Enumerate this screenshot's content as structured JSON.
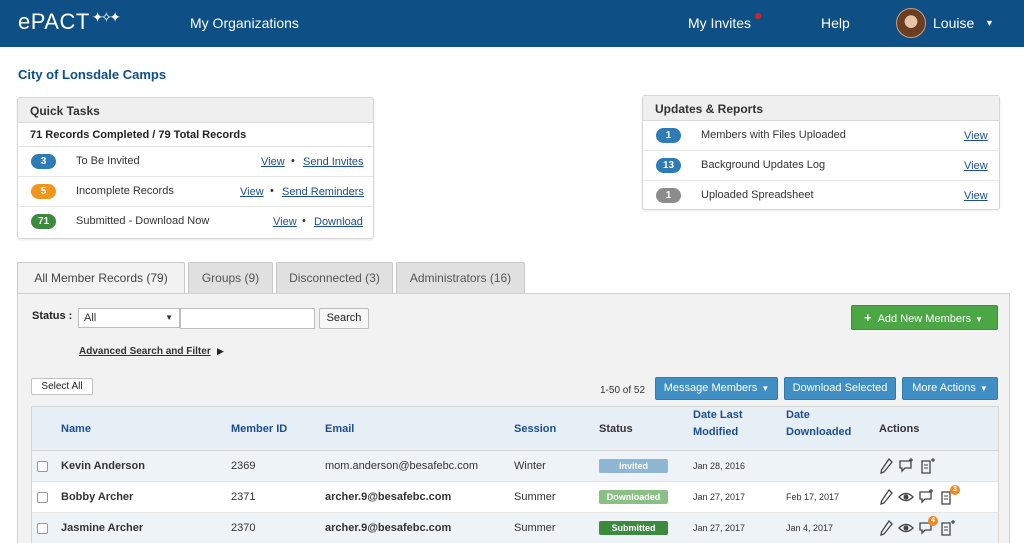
{
  "app": {
    "logo": "ePACT",
    "nav": {
      "organizations": "My Organizations",
      "invites": "My Invites",
      "help": "Help",
      "user": "Louise"
    }
  },
  "org_title": "City of Lonsdale Camps",
  "quick_tasks": {
    "title": "Quick Tasks",
    "summary": "71 Records Completed / 79 Total Records",
    "rows": [
      {
        "count": "3",
        "color": "#2e7bb6",
        "label": "To Be Invited",
        "view": "View",
        "action": "Send Invites"
      },
      {
        "count": "5",
        "color": "#f0961f",
        "label": "Incomplete Records",
        "view": "View",
        "action": "Send Reminders"
      },
      {
        "count": "71",
        "color": "#3b8a3e",
        "label": "Submitted - Download Now",
        "view": "View",
        "action": "Download"
      }
    ]
  },
  "updates_reports": {
    "title": "Updates & Reports",
    "rows": [
      {
        "count": "1",
        "color": "#2e7bb6",
        "label": "Members with Files Uploaded",
        "view": "View"
      },
      {
        "count": "13",
        "color": "#2e7bb6",
        "label": "Background Updates Log",
        "view": "View"
      },
      {
        "count": "1",
        "color": "#8c8c8c",
        "label": "Uploaded Spreadsheet",
        "view": "View"
      }
    ]
  },
  "tabs": [
    {
      "label": "All Member Records (79)",
      "active": true
    },
    {
      "label": "Groups (9)",
      "active": false
    },
    {
      "label": "Disconnected (3)",
      "active": false
    },
    {
      "label": "Administrators (16)",
      "active": false
    }
  ],
  "filters": {
    "status_label": "Status :",
    "status_value": "All",
    "search_value": "",
    "search_button": "Search",
    "advanced": "Advanced Search and Filter"
  },
  "actions": {
    "add_new": "Add New Members",
    "select_all": "Select All",
    "pager": "1-50 of 52",
    "message": "Message Members",
    "download_selected": "Download Selected",
    "more": "More Actions"
  },
  "table": {
    "headers": {
      "name": "Name",
      "member_id": "Member ID",
      "email": "Email",
      "session": "Session",
      "status": "Status",
      "date_modified_1": "Date Last",
      "date_modified_2": "Modified",
      "date_downloaded_1": "Date",
      "date_downloaded_2": "Downloaded",
      "actions": "Actions"
    },
    "rows": [
      {
        "name": "Kevin Anderson",
        "id": "2369",
        "email": "mom.anderson@besafebc.com",
        "session": "Winter",
        "status": "Invited",
        "status_color": "#8fb6d3",
        "modified": "Jan 28, 2016",
        "downloaded": "",
        "notif_count": ""
      },
      {
        "name": "Bobby Archer",
        "id": "2371",
        "email": "archer.9@besafebc.com",
        "session": "Summer",
        "status": "Downloaded",
        "status_color": "#8cbf86",
        "modified": "Jan 27, 2017",
        "downloaded": "Feb 17, 2017",
        "notif_count": "3"
      },
      {
        "name": "Jasmine Archer",
        "id": "2370",
        "email": "archer.9@besafebc.com",
        "session": "Summer",
        "status": "Submitted",
        "status_color": "#3b8a3e",
        "modified": "Jan 27, 2017",
        "downloaded": "Jan 4, 2017",
        "notif_count": "4"
      }
    ]
  },
  "colors": {
    "nav_bg": "#0e4f86",
    "accent_blue": "#3f8fc4",
    "accent_green": "#4aa744"
  }
}
